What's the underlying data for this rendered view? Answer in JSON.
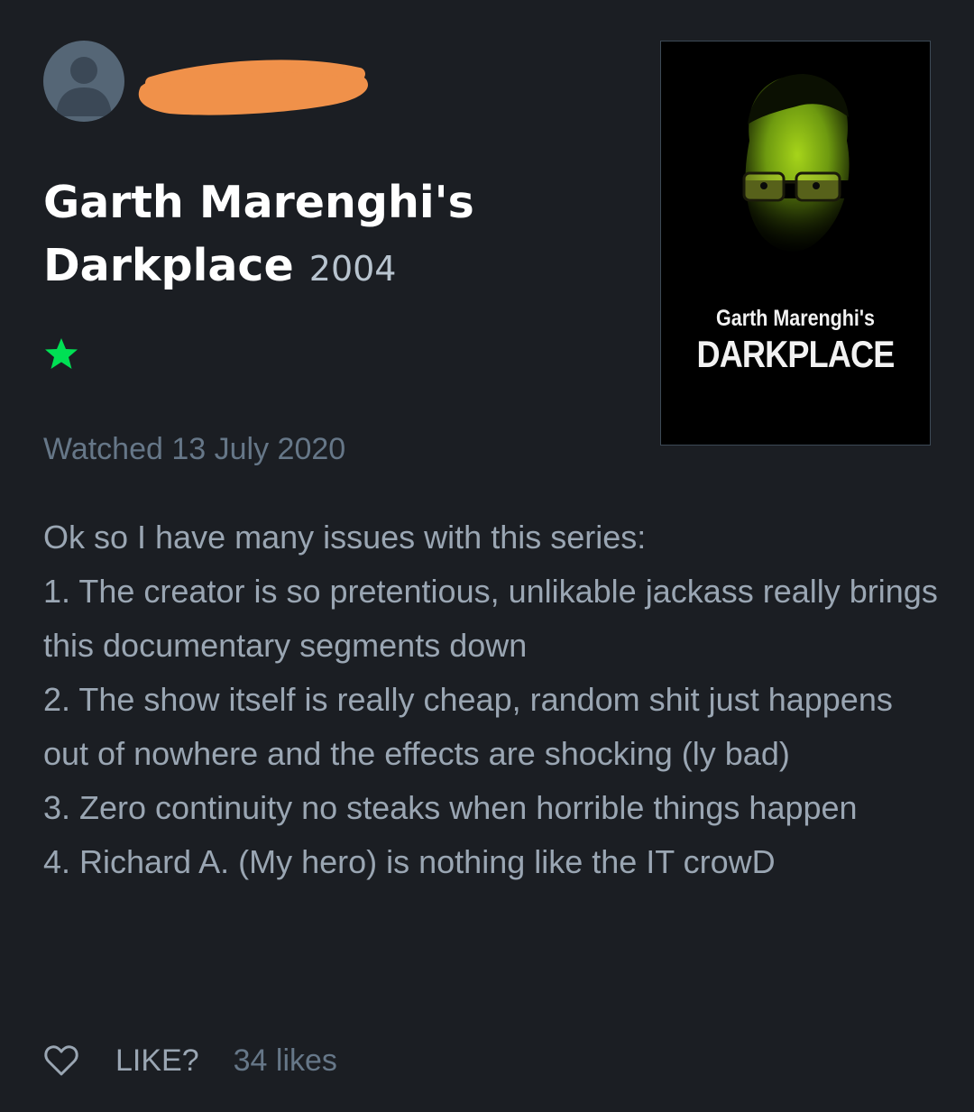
{
  "review": {
    "title": "Garth Marenghi's Darkplace",
    "year": "2004",
    "rating_stars": 1,
    "watched_label": "Watched 13 July 2020",
    "body": "Ok so I have many issues with this series:\n1. The creator is so pretentious, unlikable jackass really brings this documentary segments down\n2. The show itself is really cheap, random shit just happens out of nowhere and the effects are shocking (ly bad)\n3. Zero continuity no steaks when horrible things happen\n4. Richard A. (My hero) is nothing like the IT crowD"
  },
  "poster": {
    "line1": "Garth Marenghi's",
    "line2": "DARKPLACE"
  },
  "actions": {
    "like_label": "LIKE?",
    "likes_count": "34 likes"
  },
  "colors": {
    "background": "#1b1e23",
    "star": "#00e054",
    "redaction": "#f0914a",
    "avatar": "#556676"
  },
  "icons": {
    "avatar": "person-icon",
    "rating": "star-icon",
    "like": "heart-icon"
  }
}
